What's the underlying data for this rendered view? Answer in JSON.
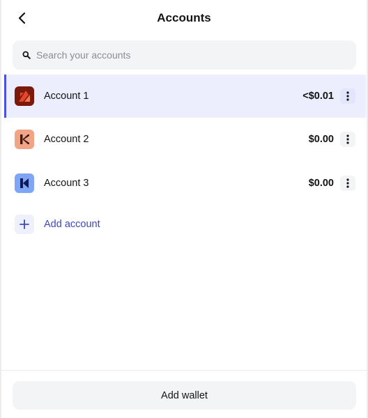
{
  "header": {
    "title": "Accounts"
  },
  "search": {
    "placeholder": "Search your accounts",
    "value": ""
  },
  "accounts": [
    {
      "name": "Account 1",
      "balance": "<$0.01",
      "selected": true,
      "logo_bg": "#7a1a0c",
      "logo_fg": "#e8452c"
    },
    {
      "name": "Account 2",
      "balance": "$0.00",
      "selected": false,
      "logo_bg": "#f2a486",
      "logo_fg": "#3a1a12"
    },
    {
      "name": "Account 3",
      "balance": "$0.00",
      "selected": false,
      "logo_bg": "#7ea6f5",
      "logo_fg": "#0f1a5a"
    }
  ],
  "add_account": {
    "label": "Add account"
  },
  "footer": {
    "add_wallet_label": "Add wallet"
  },
  "colors": {
    "accent": "#4a53d6",
    "selected_bg": "#eceefd",
    "link": "#3b48b8"
  }
}
